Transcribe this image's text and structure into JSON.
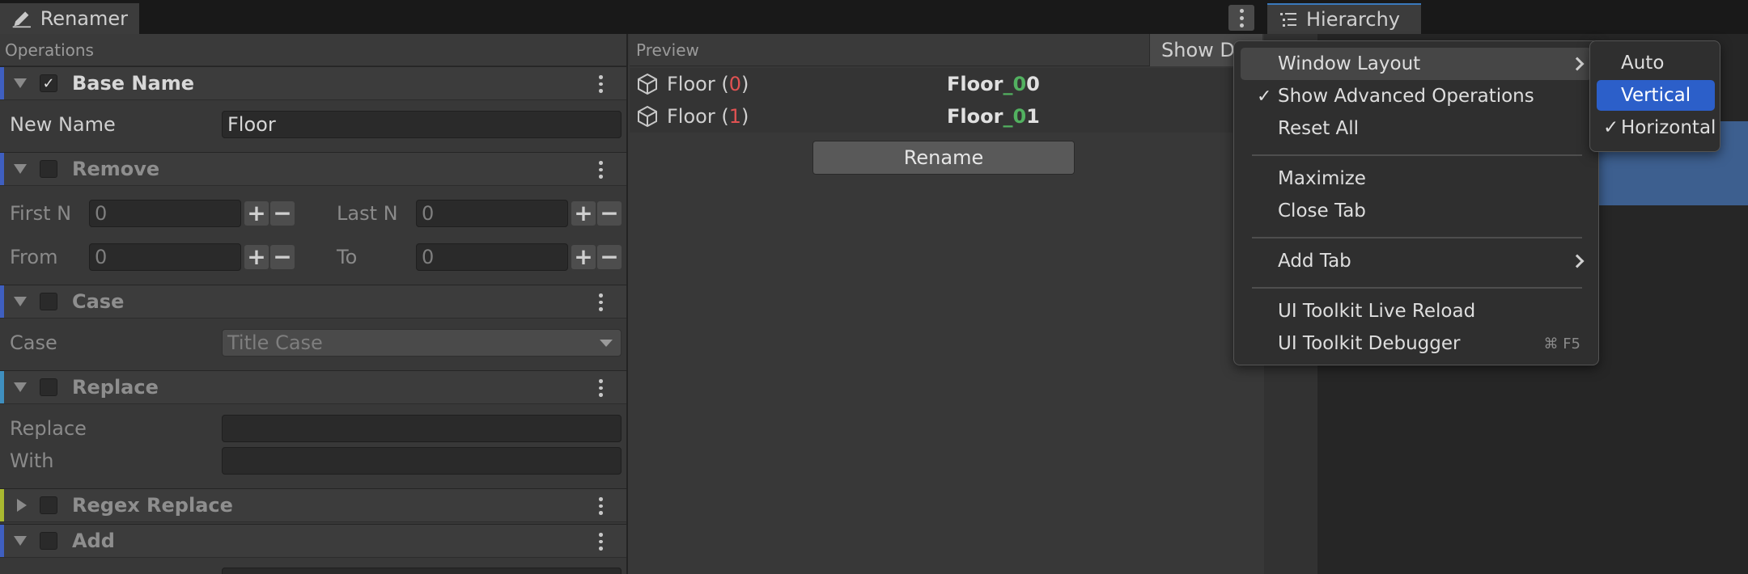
{
  "tabs": {
    "renamer": "Renamer",
    "hierarchy": "Hierarchy"
  },
  "operations_header": "Operations",
  "preview_header": "Preview",
  "show_diff_label": "Show Di",
  "sections": {
    "base_name": {
      "title": "Base Name",
      "checked": true,
      "new_name_label": "New Name",
      "new_name_value": "Floor"
    },
    "remove": {
      "title": "Remove",
      "first_n_label": "First N",
      "first_n_value": "0",
      "last_n_label": "Last N",
      "last_n_value": "0",
      "from_label": "From",
      "from_value": "0",
      "to_label": "To",
      "to_value": "0"
    },
    "case": {
      "title": "Case",
      "case_label": "Case",
      "case_value": "Title Case"
    },
    "replace": {
      "title": "Replace",
      "replace_label": "Replace",
      "with_label": "With"
    },
    "regex_replace": {
      "title": "Regex Replace"
    },
    "add": {
      "title": "Add"
    }
  },
  "stepper": {
    "plus": "+",
    "minus": "−"
  },
  "preview_rows": [
    {
      "orig_base": "Floor ",
      "orig_open": "(",
      "orig_index": "0",
      "orig_close": ")",
      "new_base": "Floor",
      "new_added": "_0",
      "new_tail": "0"
    },
    {
      "orig_base": "Floor ",
      "orig_open": "(",
      "orig_index": "1",
      "orig_close": ")",
      "new_base": "Floor",
      "new_added": "_0",
      "new_tail": "1"
    }
  ],
  "rename_button": "Rename",
  "context_menu": {
    "window_layout": "Window Layout",
    "show_advanced": "Show Advanced Operations",
    "reset_all": "Reset All",
    "maximize": "Maximize",
    "close_tab": "Close Tab",
    "add_tab": "Add Tab",
    "live_reload": "UI Toolkit Live Reload",
    "debugger": "UI Toolkit Debugger",
    "debugger_shortcut": "⌘ F5",
    "checkmark": "✓"
  },
  "layout_submenu": {
    "auto": "Auto",
    "vertical": "Vertical",
    "horizontal": "Horizontal",
    "checkmark": "✓"
  },
  "colors": {
    "accent_blue": "#2c5fc9",
    "diff_red": "#e05252",
    "diff_green": "#52b160"
  }
}
